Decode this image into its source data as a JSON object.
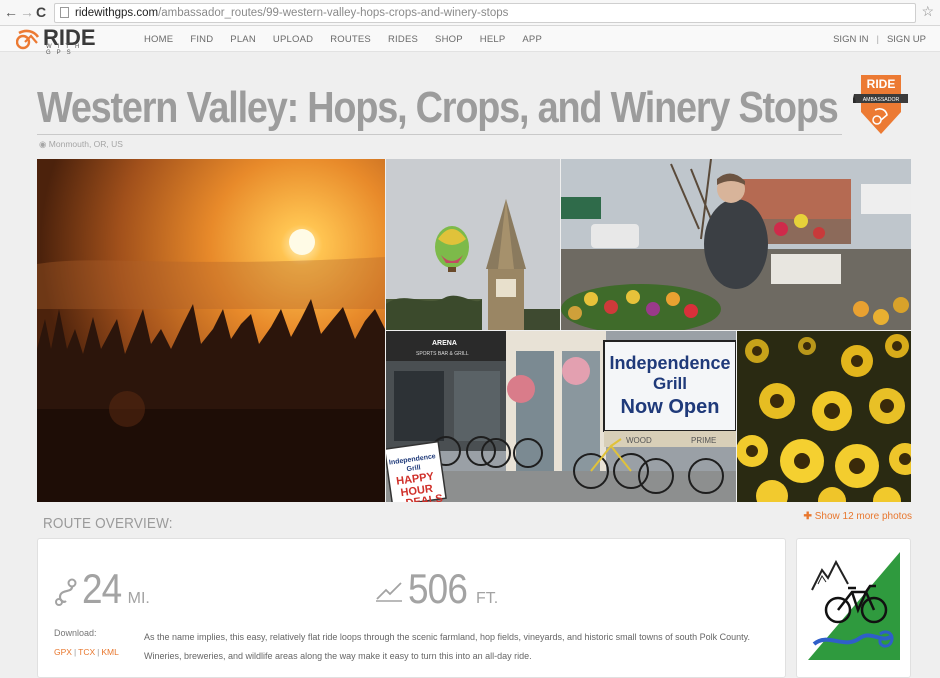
{
  "browser": {
    "url_host": "ridewithgps.com",
    "url_path": "/ambassador_routes/99-western-valley-hops-crops-and-winery-stops"
  },
  "site": {
    "logo_word": "RIDE",
    "logo_sub": "WITH GPS",
    "nav": [
      "HOME",
      "FIND",
      "PLAN",
      "UPLOAD",
      "ROUTES",
      "RIDES",
      "SHOP",
      "HELP",
      "APP"
    ],
    "sign_in": "SIGN IN",
    "sign_separator": "|",
    "sign_up": "SIGN UP"
  },
  "route": {
    "title": "Western Valley: Hops, Crops, and Winery Stops",
    "location": "Monmouth, OR, US",
    "badge_top": "RIDE",
    "badge_sub": "AMBASSADOR"
  },
  "gallery": {
    "tiles": [
      "sunset-trees",
      "balloon-tower",
      "farmers-market-tulips",
      "independence-grill-bikes",
      "sunflowers"
    ],
    "grill_sign_line1": "Independence",
    "grill_sign_line2": "Grill",
    "grill_sign_line3": "Now Open",
    "awning_line1": "ARENA",
    "awning_line2": "SPORTS BAR & GRILL",
    "board_line1": "Independence",
    "board_line2": "Grill",
    "board_line3": "HAPPY",
    "board_line4": "HOUR",
    "board_line5": "DEALS",
    "window_text1": "WOOD",
    "window_text2": "PRIME"
  },
  "overview": {
    "heading": "ROUTE OVERVIEW:",
    "more_photos": "Show 12 more photos",
    "distance_value": "24",
    "distance_unit": "MI.",
    "elevation_value": "506",
    "elevation_unit": "FT.",
    "download_label": "Download:",
    "downloads": [
      "GPX",
      "TCX",
      "KML"
    ],
    "download_separator": "|",
    "description": "As the name implies, this easy, relatively flat ride loops through the scenic farmland, hop fields, vineyards, and historic small towns of south Polk County. Wineries, breweries, and wildlife areas along the way make it easy to turn this into an all-day ride."
  },
  "colors": {
    "accent": "#e8772e",
    "title_gray": "#9c9c9c",
    "badge_orange": "#ec7a33"
  }
}
